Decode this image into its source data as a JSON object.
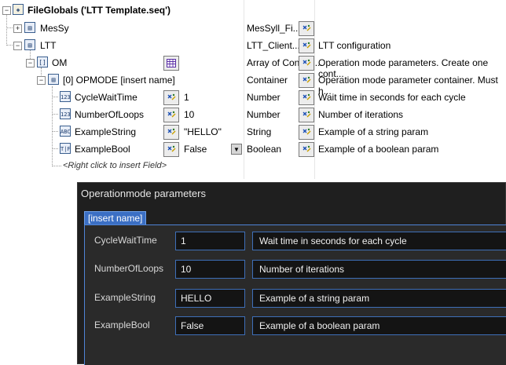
{
  "tree": {
    "root_label": "FileGlobals ('LTT Template.seq')",
    "rows": [
      {
        "label": "MesSy",
        "type": "MesSyll_Fi...",
        "desc": ""
      },
      {
        "label": "LTT",
        "type": "LTT_Client...",
        "desc": "LTT configuration"
      },
      {
        "label": "OM",
        "type": "Array of Contain...",
        "desc": "Operation mode parameters. Create one cont..."
      },
      {
        "label": "[0] OPMODE [insert name]",
        "type": "Container",
        "desc": "Operation mode parameter container. Must h..."
      },
      {
        "label": "CycleWaitTime",
        "value": "1",
        "type": "Number",
        "desc": "Wait time in seconds for each cycle"
      },
      {
        "label": "NumberOfLoops",
        "value": "10",
        "type": "Number",
        "desc": "Number of iterations"
      },
      {
        "label": "ExampleString",
        "value": "\"HELLO\"",
        "type": "String",
        "desc": "Example of a string param"
      },
      {
        "label": "ExampleBool",
        "value": "False",
        "type": "Boolean",
        "desc": "Example of a boolean param"
      }
    ],
    "insert_hint": "<Right click to insert Field>",
    "icons": {
      "number": "123",
      "string": "ABC",
      "bool": "T|F",
      "container": "[]"
    }
  },
  "panel": {
    "title": "Operationmode parameters",
    "tab": "[insert name]",
    "params": [
      {
        "name": "CycleWaitTime",
        "value": "1",
        "desc": "Wait time in seconds for each cycle"
      },
      {
        "name": "NumberOfLoops",
        "value": "10",
        "desc": "Number of iterations"
      },
      {
        "name": "ExampleString",
        "value": "HELLO",
        "desc": "Example of a string param"
      },
      {
        "name": "ExampleBool",
        "value": "False",
        "desc": "Example of a boolean param"
      }
    ]
  },
  "colors": {
    "panel_bg": "#1f1f1f",
    "accent": "#3b6fc4"
  }
}
